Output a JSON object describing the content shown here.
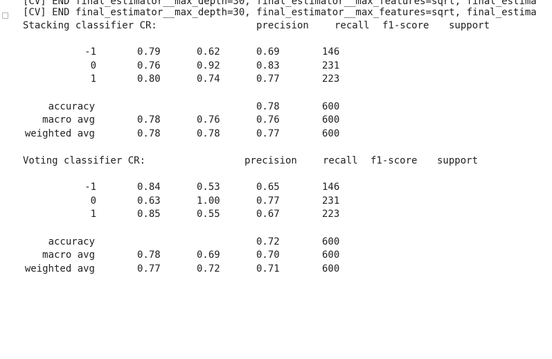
{
  "log_lines": [
    "[CV] END final_estimator__max_depth=30, final_estimator__max_features=sqrt, final_estima",
    "[CV] END final_estimator__max_depth=30, final_estimator__max_features=sqrt, final_estima"
  ],
  "reports": [
    {
      "title": "Stacking classifier CR:",
      "headers": [
        "precision",
        "recall",
        "f1-score",
        "support"
      ],
      "rows": [
        {
          "label": "-1",
          "v1": "0.79",
          "v2": "0.62",
          "v3": "0.69",
          "v4": "146"
        },
        {
          "label": "0",
          "v1": "0.76",
          "v2": "0.92",
          "v3": "0.83",
          "v4": "231"
        },
        {
          "label": "1",
          "v1": "0.80",
          "v2": "0.74",
          "v3": "0.77",
          "v4": "223"
        }
      ],
      "accuracy": {
        "label": "accuracy",
        "v3": "0.78",
        "v4": "600"
      },
      "macro": {
        "label": "macro avg",
        "v1": "0.78",
        "v2": "0.76",
        "v3": "0.76",
        "v4": "600"
      },
      "weighted": {
        "label": "weighted avg",
        "v1": "0.78",
        "v2": "0.78",
        "v3": "0.77",
        "v4": "600"
      }
    },
    {
      "title": "Voting classifier CR:",
      "headers": [
        "precision",
        "recall",
        "f1-score",
        "support"
      ],
      "rows": [
        {
          "label": "-1",
          "v1": "0.84",
          "v2": "0.53",
          "v3": "0.65",
          "v4": "146"
        },
        {
          "label": "0",
          "v1": "0.63",
          "v2": "1.00",
          "v3": "0.77",
          "v4": "231"
        },
        {
          "label": "1",
          "v1": "0.85",
          "v2": "0.55",
          "v3": "0.67",
          "v4": "223"
        }
      ],
      "accuracy": {
        "label": "accuracy",
        "v3": "0.72",
        "v4": "600"
      },
      "macro": {
        "label": "macro avg",
        "v1": "0.78",
        "v2": "0.69",
        "v3": "0.70",
        "v4": "600"
      },
      "weighted": {
        "label": "weighted avg",
        "v1": "0.77",
        "v2": "0.72",
        "v3": "0.71",
        "v4": "600"
      }
    }
  ]
}
